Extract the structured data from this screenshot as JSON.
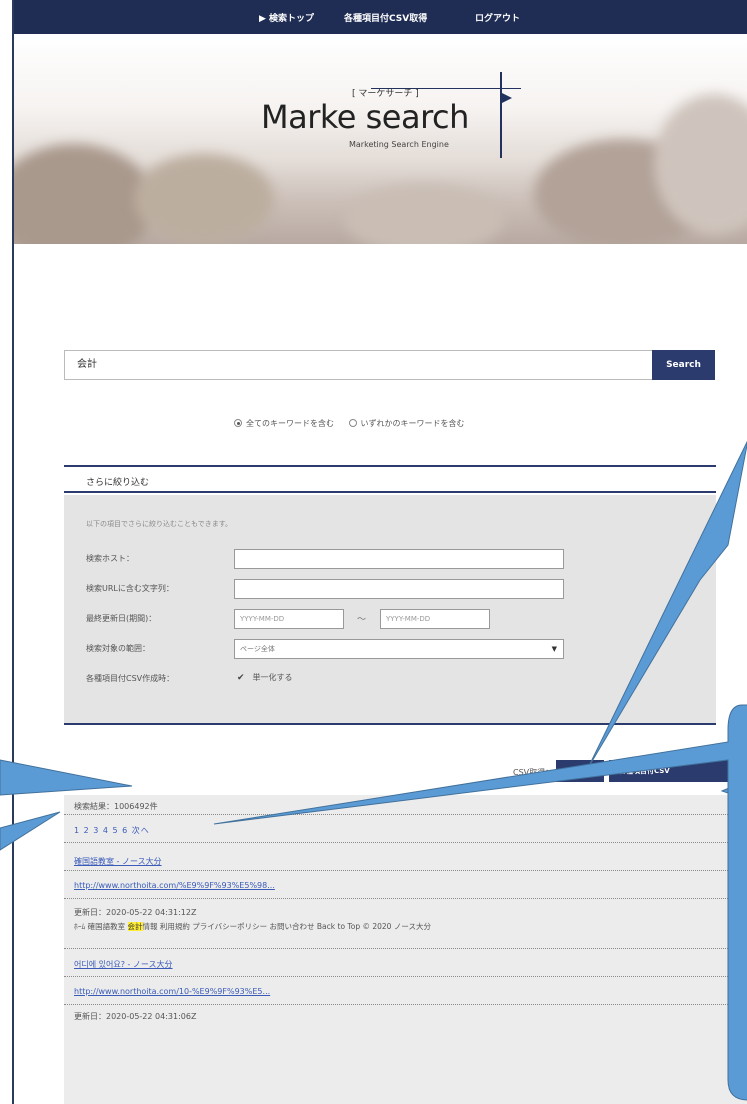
{
  "nav": {
    "items": [
      "▶ 検索トップ",
      "各種項目付CSV取得",
      "ログアウト"
    ]
  },
  "logo": {
    "kana": "[ マーケサーチ ]",
    "name": "Marke search",
    "tagline": "Marketing Search Engine"
  },
  "search": {
    "value": "会計",
    "button_label": "Search",
    "radio_all": "全てのキーワードを含む",
    "radio_any": "いずれかのキーワードを含む"
  },
  "filter": {
    "title": "さらに絞り込む",
    "hint": "以下の項目でさらに絞り込むこともできます。",
    "host_label": "検索ホスト：",
    "url_label": "検索URLに含む文字列：",
    "date_label": "最終更新日(期間)：",
    "date_from_placeholder": "YYYY-MM-DD",
    "date_sep": "〜",
    "date_to_placeholder": "YYYY-MM-DD",
    "scope_label": "検索対象の範囲：",
    "scope_value": "ページ全体",
    "csv_label": "各種項目付CSV作成時：",
    "csv_option": "単一化する"
  },
  "csv": {
    "label": "CSV取得：",
    "list_only": "一覧のみ",
    "with_fields": "各種項目付CSV"
  },
  "results": {
    "count": "検索結果：1006492件",
    "pager": "1 2 3 4 5 6 次へ",
    "items": [
      {
        "title": "確国語教室 - ノース大分",
        "url": "http://www.northoita.com/%E9%9F%93%E5%98...",
        "updated": "更新日：2020-05-22 04:31:12Z",
        "snippet_pre": "ﾎｰﾑ 確国語教室 ",
        "snippet_hl": "会計",
        "snippet_post": "情報 利用規約 プライバシーポリシー お問い合わせ Back to Top © 2020 ノース大分"
      },
      {
        "title": "어디에 있어요? - ノース大分",
        "url": "http://www.northoita.com/10-%E9%9F%93%E5...",
        "updated": "更新日：2020-05-22 04:31:06Z"
      }
    ]
  },
  "colors": {
    "navy": "#1f2d55",
    "button": "#2b3b6e",
    "callout": "#5b9bd5",
    "link": "#3a5bb8"
  }
}
